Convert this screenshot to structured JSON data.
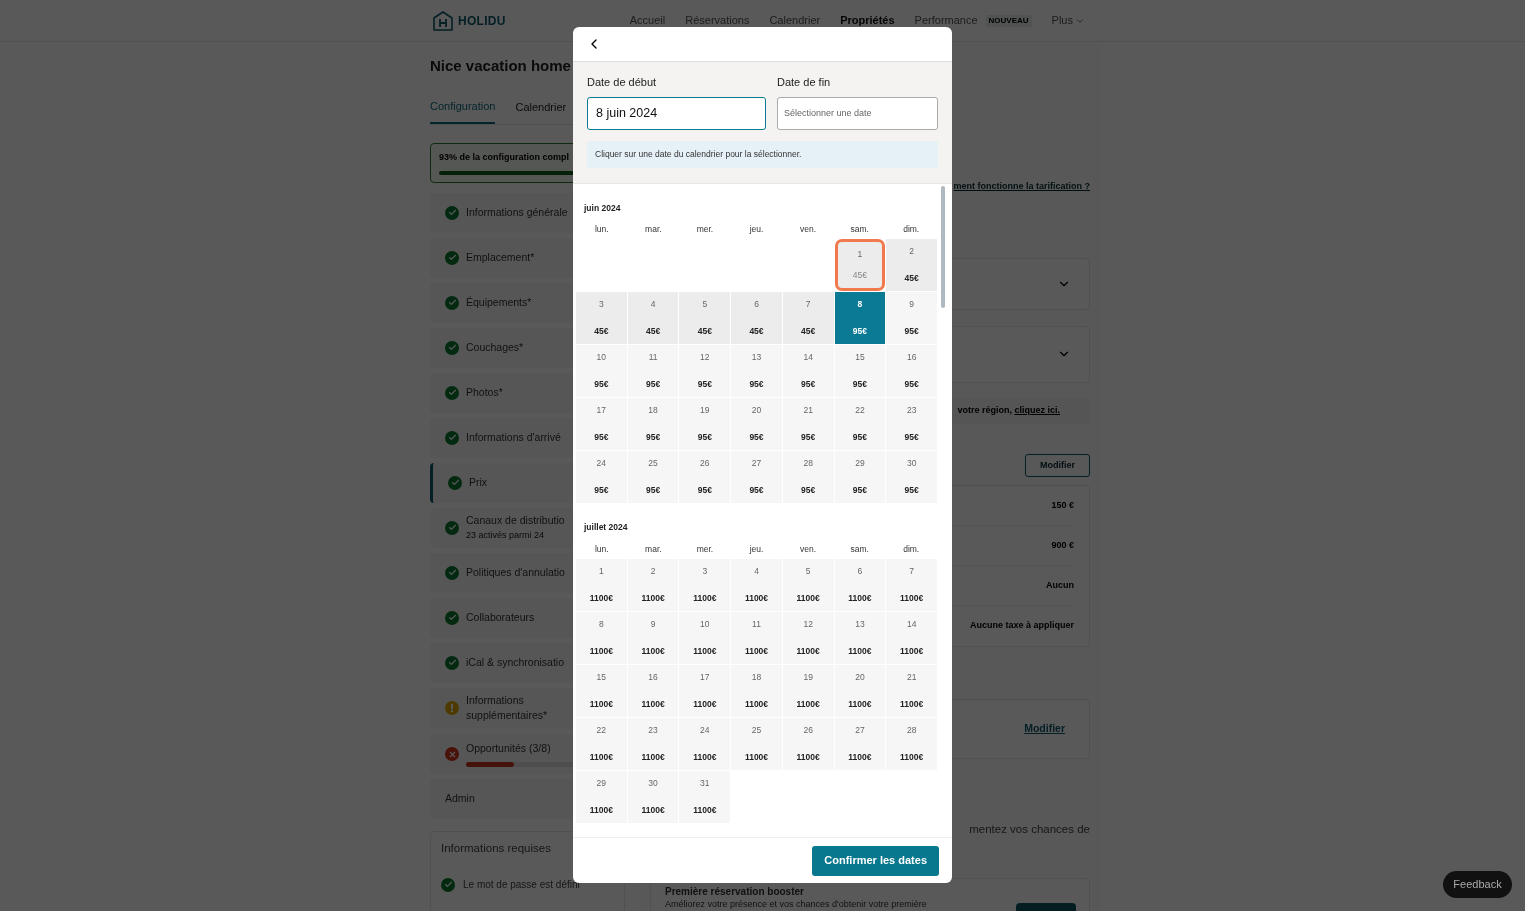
{
  "nav": {
    "logo": "HOLIDU",
    "items": [
      {
        "label": "Accueil",
        "selected": false,
        "kind": "link"
      },
      {
        "label": "Réservations",
        "selected": false,
        "kind": "link"
      },
      {
        "label": "Calendrier",
        "selected": false,
        "kind": "link"
      },
      {
        "label": "Propriétés",
        "selected": true,
        "kind": "link"
      },
      {
        "label": "Performance",
        "selected": false,
        "kind": "link",
        "badge": "NOUVEAU"
      },
      {
        "label": "Plus",
        "selected": false,
        "kind": "menu"
      }
    ]
  },
  "page": {
    "title": "Nice vacation home",
    "tabs": [
      {
        "label": "Configuration",
        "selected": true
      },
      {
        "label": "Calendrier",
        "selected": false
      }
    ]
  },
  "progress": {
    "label": "93% de la configuration compl",
    "level": 0.93
  },
  "sidebar": {
    "items": [
      {
        "label": "Informations générale",
        "kind": "complete",
        "selected": false
      },
      {
        "label": "Emplacement*",
        "kind": "complete",
        "selected": false
      },
      {
        "label": "Équipements*",
        "kind": "complete",
        "selected": false
      },
      {
        "label": "Couchages*",
        "kind": "complete",
        "selected": false
      },
      {
        "label": "Photos*",
        "kind": "complete",
        "selected": false
      },
      {
        "label": "Informations d'arrivé",
        "kind": "complete",
        "selected": false
      },
      {
        "label": "Prix",
        "kind": "complete",
        "selected": true
      },
      {
        "label": "Canaux de distributio",
        "kind": "complete",
        "selected": false,
        "subtitle": "23 activés parmi 24"
      },
      {
        "label": "Politiques d'annulatio",
        "kind": "complete",
        "selected": false
      },
      {
        "label": "Collaborateurs",
        "kind": "complete",
        "selected": false
      },
      {
        "label": "iCal & synchronisatio",
        "kind": "complete",
        "selected": false
      },
      {
        "label": "Informations supplémentaires*",
        "kind": "warning",
        "selected": false
      },
      {
        "label": "Opportunités (3/8)",
        "kind": "error",
        "selected": false,
        "level": 0.375
      },
      {
        "label": "Admin",
        "kind": "plain",
        "selected": false
      }
    ]
  },
  "required": {
    "title": "Informations requises",
    "items": [
      {
        "label": "Le mot de passe est défini",
        "done": true
      }
    ]
  },
  "pricing": {
    "help_link": "ment fonctionne la tarification ?",
    "region_note": {
      "text": "votre région, ",
      "link": "cliquez ici."
    },
    "edit_button": "Modifier",
    "fees": [
      "150 €",
      "900 €",
      "Aucun",
      "Aucune taxe à appliquer"
    ],
    "edit_link": "Modifier",
    "chances_text": "mentez vos chances de",
    "booster": {
      "title": "Première réservation booster",
      "text": "Améliorez votre présence et vos chances d'obtenir votre première"
    }
  },
  "feedback": "Feedback",
  "modal": {
    "start_label": "Date de début",
    "start_value": "8 juin 2024",
    "end_label": "Date de fin",
    "end_placeholder": "Sélectionner une date",
    "hint": "Cliquer sur une date du calendrier pour la sélectionner.",
    "confirm": "Confirmer les dates",
    "months": [
      {
        "title": "juin 2024",
        "weekdays": [
          "lun.",
          "mar.",
          "mer.",
          "jeu.",
          "ven.",
          "sam.",
          "dim."
        ],
        "cells": [
          {
            "kind": "blank"
          },
          {
            "kind": "blank"
          },
          {
            "kind": "blank"
          },
          {
            "kind": "blank"
          },
          {
            "kind": "blank"
          },
          {
            "kind": "past",
            "day": "1",
            "price": "45€",
            "selected": false,
            "highlighted": true
          },
          {
            "kind": "past",
            "day": "2",
            "price": "45€",
            "selected": false,
            "highlighted": false
          },
          {
            "kind": "past",
            "day": "3",
            "price": "45€",
            "selected": false,
            "highlighted": false
          },
          {
            "kind": "past",
            "day": "4",
            "price": "45€",
            "selected": false,
            "highlighted": false
          },
          {
            "kind": "past",
            "day": "5",
            "price": "45€",
            "selected": false,
            "highlighted": false
          },
          {
            "kind": "past",
            "day": "6",
            "price": "45€",
            "selected": false,
            "highlighted": false
          },
          {
            "kind": "past",
            "day": "7",
            "price": "45€",
            "selected": false,
            "highlighted": false
          },
          {
            "kind": "available",
            "day": "8",
            "price": "95€",
            "selected": true,
            "highlighted": false
          },
          {
            "kind": "available",
            "day": "9",
            "price": "95€",
            "selected": false,
            "highlighted": false
          },
          {
            "kind": "available",
            "day": "10",
            "price": "95€",
            "selected": false,
            "highlighted": false
          },
          {
            "kind": "available",
            "day": "11",
            "price": "95€",
            "selected": false,
            "highlighted": false
          },
          {
            "kind": "available",
            "day": "12",
            "price": "95€",
            "selected": false,
            "highlighted": false
          },
          {
            "kind": "available",
            "day": "13",
            "price": "95€",
            "selected": false,
            "highlighted": false
          },
          {
            "kind": "available",
            "day": "14",
            "price": "95€",
            "selected": false,
            "highlighted": false
          },
          {
            "kind": "available",
            "day": "15",
            "price": "95€",
            "selected": false,
            "highlighted": false
          },
          {
            "kind": "available",
            "day": "16",
            "price": "95€",
            "selected": false,
            "highlighted": false
          },
          {
            "kind": "available",
            "day": "17",
            "price": "95€",
            "selected": false,
            "highlighted": false
          },
          {
            "kind": "available",
            "day": "18",
            "price": "95€",
            "selected": false,
            "highlighted": false
          },
          {
            "kind": "available",
            "day": "19",
            "price": "95€",
            "selected": false,
            "highlighted": false
          },
          {
            "kind": "available",
            "day": "20",
            "price": "95€",
            "selected": false,
            "highlighted": false
          },
          {
            "kind": "available",
            "day": "21",
            "price": "95€",
            "selected": false,
            "highlighted": false
          },
          {
            "kind": "available",
            "day": "22",
            "price": "95€",
            "selected": false,
            "highlighted": false
          },
          {
            "kind": "available",
            "day": "23",
            "price": "95€",
            "selected": false,
            "highlighted": false
          },
          {
            "kind": "available",
            "day": "24",
            "price": "95€",
            "selected": false,
            "highlighted": false
          },
          {
            "kind": "available",
            "day": "25",
            "price": "95€",
            "selected": false,
            "highlighted": false
          },
          {
            "kind": "available",
            "day": "26",
            "price": "95€",
            "selected": false,
            "highlighted": false
          },
          {
            "kind": "available",
            "day": "27",
            "price": "95€",
            "selected": false,
            "highlighted": false
          },
          {
            "kind": "available",
            "day": "28",
            "price": "95€",
            "selected": false,
            "highlighted": false
          },
          {
            "kind": "available",
            "day": "29",
            "price": "95€",
            "selected": false,
            "highlighted": false
          },
          {
            "kind": "available",
            "day": "30",
            "price": "95€",
            "selected": false,
            "highlighted": false
          }
        ]
      },
      {
        "title": "juillet 2024",
        "weekdays": [
          "lun.",
          "mar.",
          "mer.",
          "jeu.",
          "ven.",
          "sam.",
          "dim."
        ],
        "cells": [
          {
            "kind": "available",
            "day": "1",
            "price": "1100€",
            "selected": false,
            "highlighted": false
          },
          {
            "kind": "available",
            "day": "2",
            "price": "1100€",
            "selected": false,
            "highlighted": false
          },
          {
            "kind": "available",
            "day": "3",
            "price": "1100€",
            "selected": false,
            "highlighted": false
          },
          {
            "kind": "available",
            "day": "4",
            "price": "1100€",
            "selected": false,
            "highlighted": false
          },
          {
            "kind": "available",
            "day": "5",
            "price": "1100€",
            "selected": false,
            "highlighted": false
          },
          {
            "kind": "available",
            "day": "6",
            "price": "1100€",
            "selected": false,
            "highlighted": false
          },
          {
            "kind": "available",
            "day": "7",
            "price": "1100€",
            "selected": false,
            "highlighted": false
          },
          {
            "kind": "available",
            "day": "8",
            "price": "1100€",
            "selected": false,
            "highlighted": false
          },
          {
            "kind": "available",
            "day": "9",
            "price": "1100€",
            "selected": false,
            "highlighted": false
          },
          {
            "kind": "available",
            "day": "10",
            "price": "1100€",
            "selected": false,
            "highlighted": false
          },
          {
            "kind": "available",
            "day": "11",
            "price": "1100€",
            "selected": false,
            "highlighted": false
          },
          {
            "kind": "available",
            "day": "12",
            "price": "1100€",
            "selected": false,
            "highlighted": false
          },
          {
            "kind": "available",
            "day": "13",
            "price": "1100€",
            "selected": false,
            "highlighted": false
          },
          {
            "kind": "available",
            "day": "14",
            "price": "1100€",
            "selected": false,
            "highlighted": false
          },
          {
            "kind": "available",
            "day": "15",
            "price": "1100€",
            "selected": false,
            "highlighted": false
          },
          {
            "kind": "available",
            "day": "16",
            "price": "1100€",
            "selected": false,
            "highlighted": false
          },
          {
            "kind": "available",
            "day": "17",
            "price": "1100€",
            "selected": false,
            "highlighted": false
          },
          {
            "kind": "available",
            "day": "18",
            "price": "1100€",
            "selected": false,
            "highlighted": false
          },
          {
            "kind": "available",
            "day": "19",
            "price": "1100€",
            "selected": false,
            "highlighted": false
          },
          {
            "kind": "available",
            "day": "20",
            "price": "1100€",
            "selected": false,
            "highlighted": false
          },
          {
            "kind": "available",
            "day": "21",
            "price": "1100€",
            "selected": false,
            "highlighted": false
          },
          {
            "kind": "available",
            "day": "22",
            "price": "1100€",
            "selected": false,
            "highlighted": false
          },
          {
            "kind": "available",
            "day": "23",
            "price": "1100€",
            "selected": false,
            "highlighted": false
          },
          {
            "kind": "available",
            "day": "24",
            "price": "1100€",
            "selected": false,
            "highlighted": false
          },
          {
            "kind": "available",
            "day": "25",
            "price": "1100€",
            "selected": false,
            "highlighted": false
          },
          {
            "kind": "available",
            "day": "26",
            "price": "1100€",
            "selected": false,
            "highlighted": false
          },
          {
            "kind": "available",
            "day": "27",
            "price": "1100€",
            "selected": false,
            "highlighted": false
          },
          {
            "kind": "available",
            "day": "28",
            "price": "1100€",
            "selected": false,
            "highlighted": false
          },
          {
            "kind": "available",
            "day": "29",
            "price": "1100€",
            "selected": false,
            "highlighted": false
          },
          {
            "kind": "available",
            "day": "30",
            "price": "1100€",
            "selected": false,
            "highlighted": false
          },
          {
            "kind": "available",
            "day": "31",
            "price": "1100€",
            "selected": false,
            "highlighted": false
          },
          {
            "kind": "blank"
          },
          {
            "kind": "blank"
          },
          {
            "kind": "blank"
          },
          {
            "kind": "blank"
          }
        ]
      }
    ]
  }
}
